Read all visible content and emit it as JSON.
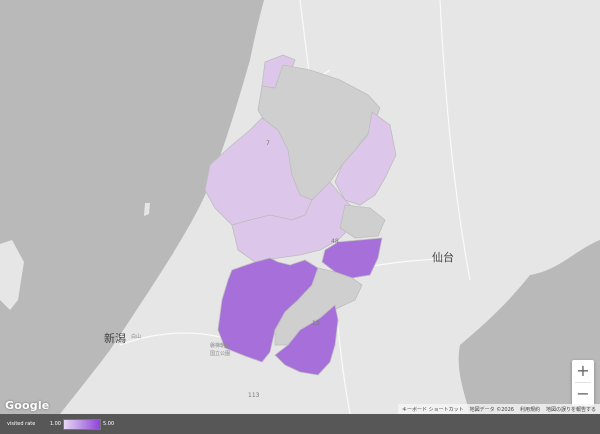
{
  "map": {
    "colors": {
      "sea": "#b9b9b9",
      "land": "#e6e6e6",
      "region_gray": "#cfcfcf",
      "region_light": "#dcc6ea",
      "region_dark": "#a66fd9",
      "border": "#aaaaaa"
    },
    "labels": {
      "niigata": "新潟",
      "sendai": "仙台",
      "hakusan": "白山",
      "park": "国立公園",
      "park2": "磐梯朝日",
      "sea_small": "",
      "road1": "48",
      "road2": "13",
      "road3": "113",
      "road4": "7"
    }
  },
  "controls": {
    "zoom_in": "+",
    "zoom_out": "−"
  },
  "attribution": {
    "logo": "Google",
    "shortcuts": "キーボード ショートカット",
    "map_data": "地図データ ©2026",
    "terms": "利用規約",
    "report": "地図の誤りを報告する"
  },
  "legend": {
    "title": "visited rate",
    "min": "1.00",
    "max": "5.00",
    "color_min": "#e6d7f2",
    "color_max": "#8e44d8"
  }
}
